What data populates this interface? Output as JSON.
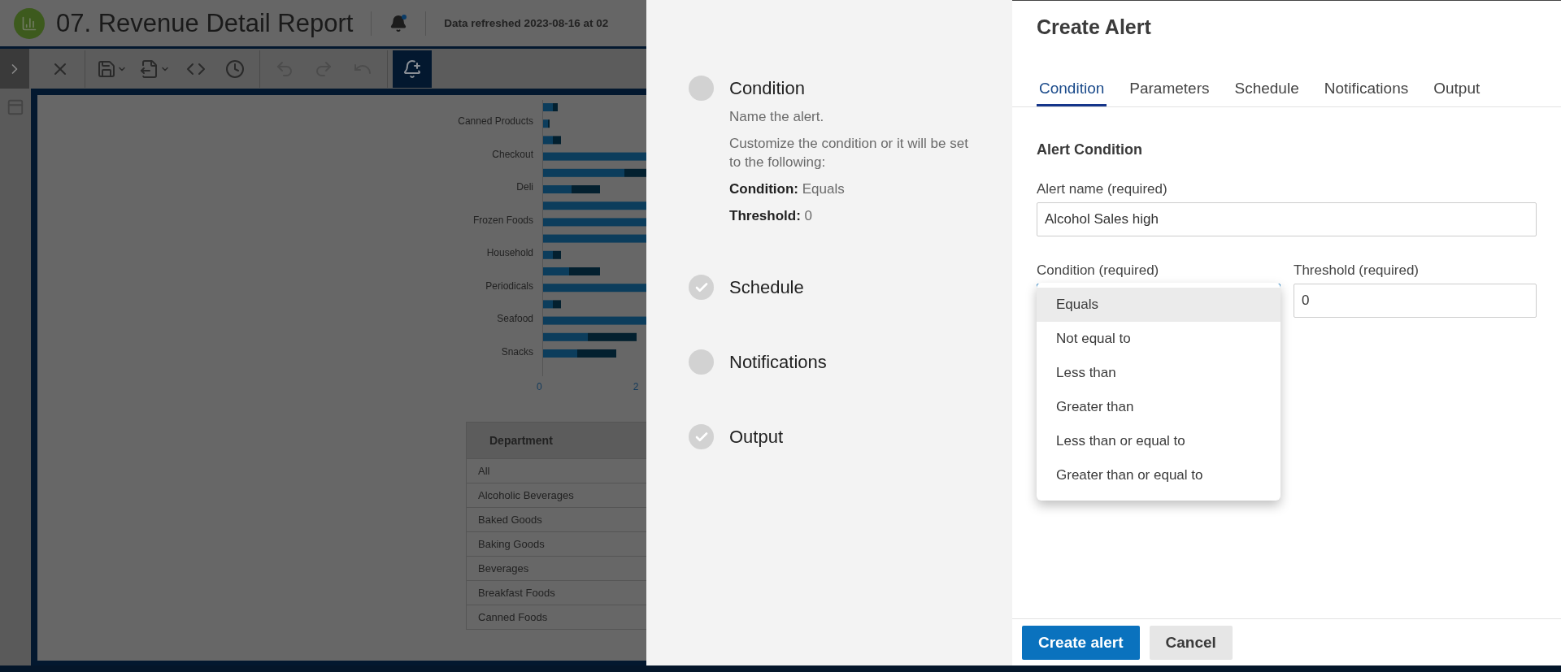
{
  "report": {
    "title": "07. Revenue Detail Report",
    "refreshed": "Data refreshed 2023-08-16 at 02"
  },
  "toolbar": [
    {
      "kind": "close",
      "disabled": false
    },
    {
      "kind": "save",
      "disabled": false
    },
    {
      "kind": "export",
      "disabled": false
    },
    {
      "kind": "code",
      "disabled": false
    },
    {
      "kind": "clock",
      "disabled": false
    },
    {
      "kind": "undo",
      "disabled": true
    },
    {
      "kind": "redo",
      "disabled": true
    },
    {
      "kind": "revert",
      "disabled": true
    },
    {
      "kind": "alert",
      "disabled": false
    }
  ],
  "chart": {
    "categories": [
      "Canned Products",
      "Checkout",
      "Deli",
      "Frozen Foods",
      "Household",
      "Periodicals",
      "Seafood",
      "Snacks"
    ],
    "ticks": [
      "0",
      "2"
    ]
  },
  "table": {
    "columns": [
      "Department"
    ],
    "rows": [
      "All",
      "Alcoholic Beverages",
      "Baked Goods",
      "Baking Goods",
      "Beverages",
      "Breakfast Foods",
      "Canned Foods"
    ]
  },
  "wizard": {
    "steps": [
      {
        "label": "Condition",
        "completed": false,
        "details": [
          "Name the alert.",
          "Customize the condition or it will be set to the following:",
          "**Condition:** Equals",
          "**Threshold:** 0"
        ]
      },
      {
        "label": "Schedule",
        "completed": true
      },
      {
        "label": "Notifications",
        "completed": false
      },
      {
        "label": "Output",
        "completed": true
      }
    ]
  },
  "dialog": {
    "title": "Create Alert",
    "tabs": [
      {
        "label": "Condition",
        "selected": true
      },
      {
        "label": "Parameters",
        "selected": false
      },
      {
        "label": "Schedule",
        "selected": false
      },
      {
        "label": "Notifications",
        "selected": false
      },
      {
        "label": "Output",
        "selected": false
      }
    ],
    "section_title": "Alert Condition",
    "alert_name": {
      "label": "Alert name (required)",
      "value": "Alcohol Sales high"
    },
    "condition": {
      "label": "Condition (required)",
      "options": [
        {
          "label": "Equals",
          "selected": true
        },
        {
          "label": "Not equal to",
          "selected": false
        },
        {
          "label": "Less than",
          "selected": false
        },
        {
          "label": "Greater than",
          "selected": false
        },
        {
          "label": "Less than or equal to",
          "selected": false
        },
        {
          "label": "Greater than or equal to",
          "selected": false
        }
      ]
    },
    "threshold": {
      "label": "Threshold (required)",
      "value": "0"
    },
    "buttons": [
      {
        "label": "Create alert",
        "kind": "primary"
      },
      {
        "label": "Cancel",
        "kind": "secondary"
      }
    ]
  }
}
